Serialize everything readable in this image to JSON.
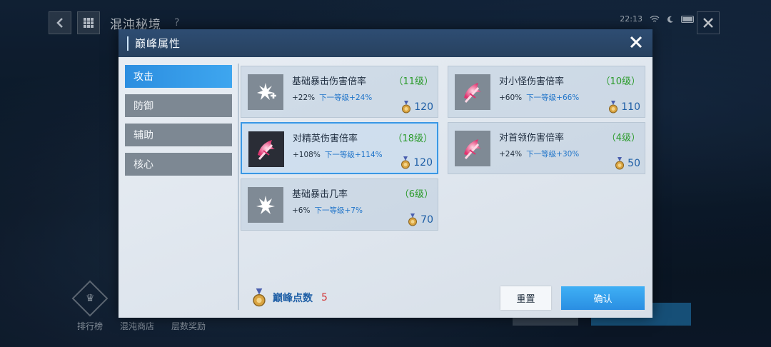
{
  "background": {
    "title": "混沌秘境",
    "help": "?",
    "status": {
      "time": "22:13"
    },
    "bottom_nav": [
      {
        "label": "排行榜"
      },
      {
        "label": "混沌商店"
      },
      {
        "label": "层数奖励"
      }
    ]
  },
  "modal": {
    "title": "巅峰属性",
    "close_label": "✕",
    "tabs": [
      {
        "label": "攻击",
        "active": true
      },
      {
        "label": "防御",
        "active": false
      },
      {
        "label": "辅助",
        "active": false
      },
      {
        "label": "核心",
        "active": false
      }
    ],
    "cards": [
      {
        "name": "基础暴击伤害倍率",
        "level": "（11级）",
        "current": "+22%",
        "next": "下一等级+24%",
        "cost": "120",
        "icon": "crit-damage-plus-icon"
      },
      {
        "name": "对小怪伤害倍率",
        "level": "（10级）",
        "current": "+60%",
        "next": "下一等级+66%",
        "cost": "110",
        "icon": "axe-icon"
      },
      {
        "name": "对精英伤害倍率",
        "level": "（18级）",
        "current": "+108%",
        "next": "下一等级+114%",
        "cost": "120",
        "icon": "axe-icon"
      },
      {
        "name": "对首领伤害倍率",
        "level": "（4级）",
        "current": "+24%",
        "next": "下一等级+30%",
        "cost": "50",
        "icon": "axe-icon"
      },
      {
        "name": "基础暴击几率",
        "level": "（6级）",
        "current": "+6%",
        "next": "下一等级+7%",
        "cost": "70",
        "icon": "crit-chance-icon"
      }
    ],
    "points_label": "巅峰点数",
    "points_value": "5",
    "reset_label": "重置",
    "confirm_label": "确认"
  },
  "colors": {
    "accent": "#3aa4ef",
    "level_green": "#2a9a2a",
    "cost_blue": "#1f5fa6",
    "points_red": "#d23a3a"
  }
}
